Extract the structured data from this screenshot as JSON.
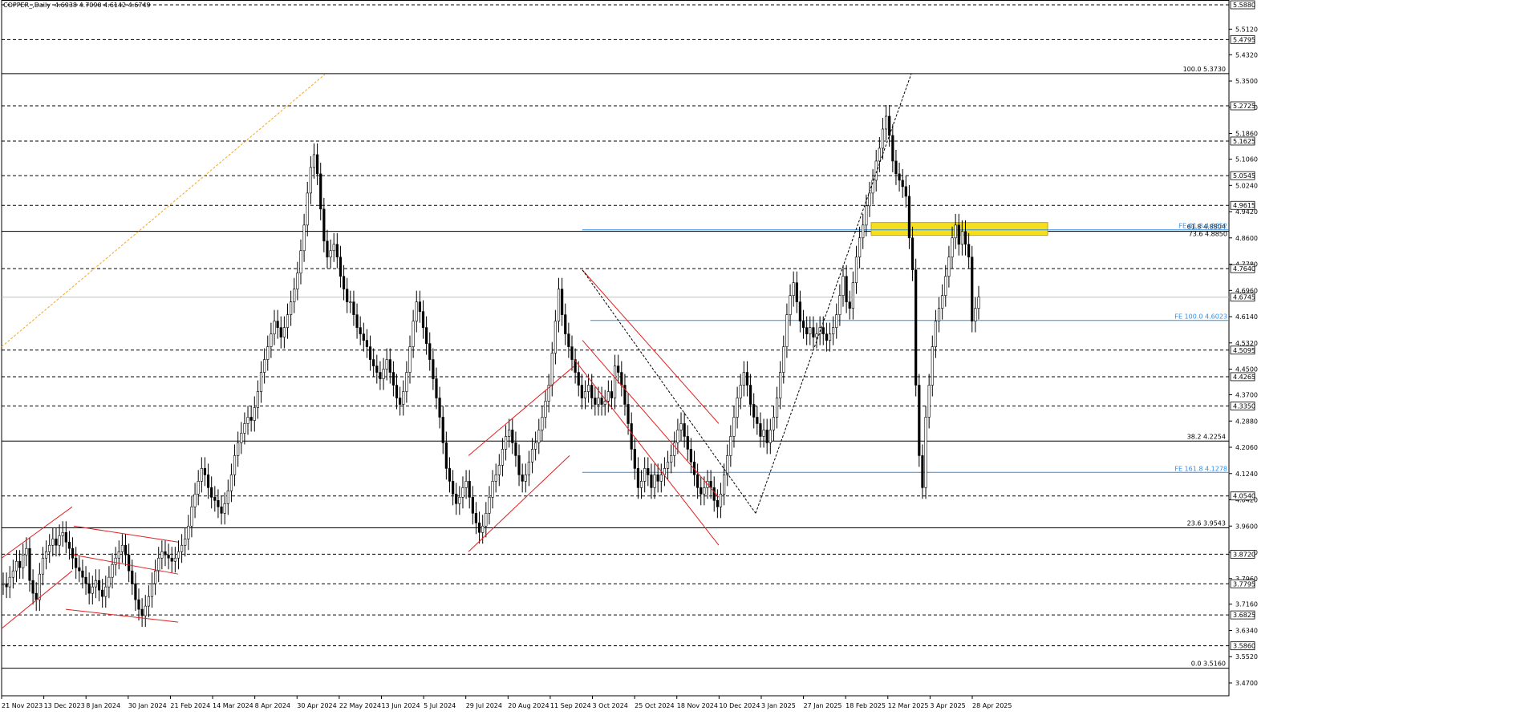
{
  "header": {
    "symbol": "COPPER_,Daily",
    "ohlc": "4.6938 4.7090 4.6142 4.6749"
  },
  "chart_data": {
    "type": "candlestick",
    "ylim": [
      3.47,
      5.588
    ],
    "y_ticks": [
      5.512,
      5.432,
      5.35,
      5.268,
      5.186,
      5.106,
      5.024,
      4.942,
      4.86,
      4.778,
      4.696,
      4.614,
      4.532,
      4.45,
      4.37,
      4.288,
      4.206,
      4.124,
      4.042,
      3.96,
      3.878,
      3.796,
      3.716,
      3.634,
      3.552,
      3.47
    ],
    "y_tick_labels": [
      "5.5120",
      "5.4320",
      "5.3500",
      "5.2680",
      "5.1860",
      "5.1060",
      "5.0240",
      "4.9420",
      "4.8600",
      "4.7780",
      "4.6960",
      "4.6140",
      "4.5320",
      "4.4500",
      "4.3700",
      "4.2880",
      "4.2060",
      "4.1240",
      "4.0420",
      "3.9600",
      "3.8780",
      "3.7960",
      "3.7160",
      "3.6340",
      "3.5520",
      "3.4700"
    ],
    "x_date_labels": [
      "21 Nov 2023",
      "13 Dec 2023",
      "8 Jan 2024",
      "30 Jan 2024",
      "21 Feb 2024",
      "14 Mar 2024",
      "8 Apr 2024",
      "30 Apr 2024",
      "22 May 2024",
      "13 Jun 2024",
      "5 Jul 2024",
      "29 Jul 2024",
      "20 Aug 2024",
      "11 Sep 2024",
      "3 Oct 2024",
      "25 Oct 2024",
      "18 Nov 2024",
      "10 Dec 2024",
      "3 Jan 2025",
      "27 Jan 2025",
      "18 Feb 2025",
      "12 Mar 2025",
      "3 Apr 2025",
      "28 Apr 2025"
    ],
    "dashed_levels": [
      {
        "value": 5.588,
        "label": "5.5880"
      },
      {
        "value": 5.4795,
        "label": "5.4795"
      },
      {
        "value": 5.2725,
        "label": "5.2725"
      },
      {
        "value": 5.1625,
        "label": "5.1625"
      },
      {
        "value": 5.0545,
        "label": "5.0545"
      },
      {
        "value": 4.9615,
        "label": "4.9615"
      },
      {
        "value": 4.764,
        "label": "4.7640"
      },
      {
        "value": 4.5095,
        "label": "4.5095"
      },
      {
        "value": 4.4265,
        "label": "4.4265"
      },
      {
        "value": 4.335,
        "label": "4.3350"
      },
      {
        "value": 4.054,
        "label": "4.0540"
      },
      {
        "value": 3.872,
        "label": "3.8720"
      },
      {
        "value": 3.7795,
        "label": "3.7795"
      },
      {
        "value": 3.6825,
        "label": "3.6825"
      },
      {
        "value": 3.586,
        "label": "3.5860"
      }
    ],
    "current_price": {
      "value": 4.6749,
      "label": "4.6745"
    },
    "fib_retracement": [
      {
        "value": 5.373,
        "label": "100.0 5.3730"
      },
      {
        "value": 4.8804,
        "label": "61.8 4.8804"
      },
      {
        "value": 4.2254,
        "label": "38.2 4.2254"
      },
      {
        "value": 3.9543,
        "label": "23.6 3.9543"
      },
      {
        "value": 3.516,
        "label": "0.0 3.5160"
      }
    ],
    "fib_expansion": [
      {
        "value": 4.8852,
        "label": "FE 61.8 4.8852"
      },
      {
        "value": 4.6023,
        "label": "FE 100.0 4.6023"
      },
      {
        "value": 4.1278,
        "label": "FE 161.8 4.1278"
      }
    ],
    "fib_overlap_label": "73.6 4.8850",
    "resistance_zone": [
      4.868,
      4.908
    ],
    "closes": [
      3.78,
      3.77,
      3.8,
      3.82,
      3.85,
      3.83,
      3.87,
      3.89,
      3.79,
      3.75,
      3.73,
      3.81,
      3.86,
      3.88,
      3.9,
      3.92,
      3.9,
      3.93,
      3.94,
      3.91,
      3.89,
      3.86,
      3.83,
      3.82,
      3.8,
      3.78,
      3.75,
      3.77,
      3.79,
      3.76,
      3.74,
      3.77,
      3.8,
      3.84,
      3.86,
      3.88,
      3.9,
      3.87,
      3.82,
      3.78,
      3.73,
      3.7,
      3.68,
      3.71,
      3.74,
      3.78,
      3.82,
      3.86,
      3.88,
      3.87,
      3.86,
      3.85,
      3.86,
      3.88,
      3.9,
      3.92,
      3.96,
      4.02,
      4.06,
      4.1,
      4.14,
      4.12,
      4.08,
      4.05,
      4.04,
      4.02,
      4.0,
      4.03,
      4.07,
      4.12,
      4.18,
      4.22,
      4.25,
      4.28,
      4.3,
      4.29,
      4.33,
      4.38,
      4.44,
      4.48,
      4.52,
      4.56,
      4.6,
      4.58,
      4.55,
      4.58,
      4.62,
      4.66,
      4.7,
      4.75,
      4.82,
      4.9,
      5.0,
      5.08,
      5.12,
      5.06,
      4.95,
      4.85,
      4.8,
      4.82,
      4.84,
      4.8,
      4.74,
      4.7,
      4.66,
      4.66,
      4.62,
      4.58,
      4.56,
      4.54,
      4.52,
      4.48,
      4.46,
      4.44,
      4.42,
      4.45,
      4.48,
      4.44,
      4.4,
      4.36,
      4.34,
      4.38,
      4.44,
      4.52,
      4.6,
      4.66,
      4.63,
      4.58,
      4.53,
      4.48,
      4.42,
      4.36,
      4.3,
      4.22,
      4.14,
      4.1,
      4.06,
      4.03,
      4.05,
      4.08,
      4.1,
      4.05,
      4.0,
      3.97,
      3.94,
      3.96,
      4.0,
      4.05,
      4.1,
      4.12,
      4.15,
      4.2,
      4.24,
      4.26,
      4.22,
      4.18,
      4.12,
      4.1,
      4.12,
      4.16,
      4.2,
      4.22,
      4.26,
      4.3,
      4.35,
      4.4,
      4.5,
      4.6,
      4.7,
      4.62,
      4.56,
      4.52,
      4.48,
      4.44,
      4.4,
      4.36,
      4.38,
      4.4,
      4.36,
      4.34,
      4.36,
      4.34,
      4.35,
      4.38,
      4.36,
      4.46,
      4.44,
      4.4,
      4.34,
      4.28,
      4.2,
      4.14,
      4.08,
      4.1,
      4.14,
      4.12,
      4.08,
      4.12,
      4.1,
      4.12,
      4.14,
      4.16,
      4.18,
      4.22,
      4.26,
      4.28,
      4.24,
      4.2,
      4.16,
      4.12,
      4.08,
      4.06,
      4.08,
      4.1,
      4.08,
      4.04,
      4.02,
      4.06,
      4.12,
      4.18,
      4.24,
      4.3,
      4.36,
      4.4,
      4.44,
      4.4,
      4.34,
      4.3,
      4.28,
      4.24,
      4.26,
      4.22,
      4.26,
      4.3,
      4.36,
      4.44,
      4.52,
      4.62,
      4.68,
      4.72,
      4.66,
      4.6,
      4.58,
      4.56,
      4.58,
      4.55,
      4.56,
      4.58,
      4.56,
      4.54,
      4.56,
      4.58,
      4.62,
      4.68,
      4.74,
      4.66,
      4.64,
      4.72,
      4.8,
      4.86,
      4.9,
      4.96,
      5.0,
      5.04,
      5.1,
      5.14,
      5.2,
      5.24,
      5.18,
      5.1,
      5.06,
      5.04,
      5.02,
      4.99,
      4.86,
      4.76,
      4.4,
      4.18,
      4.08,
      4.3,
      4.4,
      4.52,
      4.6,
      4.64,
      4.68,
      4.74,
      4.8,
      4.86,
      4.9,
      4.84,
      4.88,
      4.84,
      4.8,
      4.6,
      4.64,
      4.6749
    ]
  }
}
